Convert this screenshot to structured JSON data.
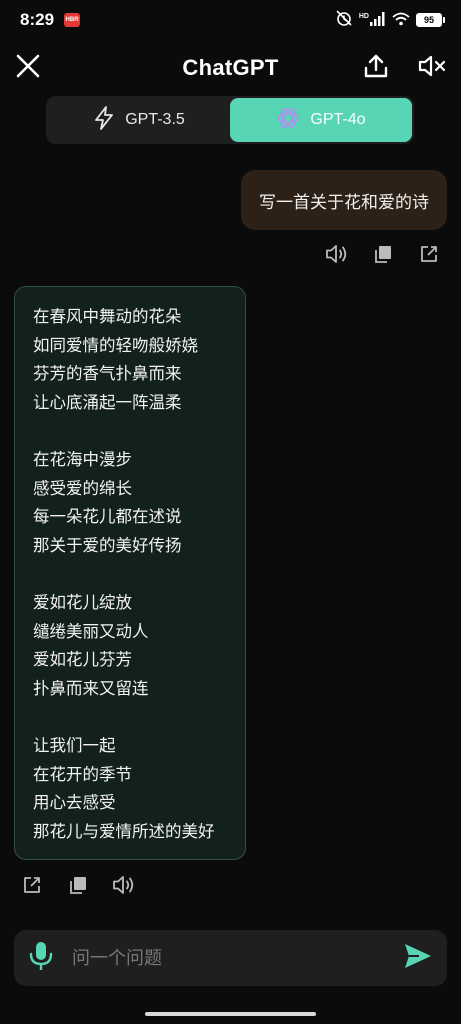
{
  "status_bar": {
    "time": "8:29",
    "app_badge": "HBR",
    "battery": "95",
    "network_label": "HD"
  },
  "header": {
    "title": "ChatGPT",
    "close_icon": "close-icon",
    "share_icon": "upload-icon",
    "mute_icon": "speaker-mute-icon"
  },
  "model_switch": {
    "options": [
      {
        "label": "GPT-3.5",
        "icon": "lightning-icon",
        "active": false
      },
      {
        "label": "GPT-4o",
        "icon": "openai-logo-icon",
        "active": true
      }
    ]
  },
  "conversation": {
    "user_message": "写一首关于花和爱的诗",
    "poem_stanzas": [
      [
        "在春风中舞动的花朵",
        "如同爱情的轻吻般娇娆",
        "芬芳的香气扑鼻而来",
        "让心底涌起一阵温柔"
      ],
      [
        "在花海中漫步",
        "感受爱的绵长",
        "每一朵花儿都在述说",
        "那关于爱的美好传扬"
      ],
      [
        "爱如花儿绽放",
        "缱绻美丽又动人",
        "爱如花儿芬芳",
        "扑鼻而来又留连"
      ],
      [
        "让我们一起",
        "在花开的季节",
        "用心去感受",
        "那花儿与爱情所述的美好"
      ]
    ]
  },
  "input": {
    "placeholder": "问一个问题"
  },
  "colors": {
    "accent": "#57d5b4",
    "background": "#0b0b0b",
    "user_bubble": "#2c2017",
    "bot_bubble": "#13211c",
    "bot_border": "#2f5145"
  }
}
